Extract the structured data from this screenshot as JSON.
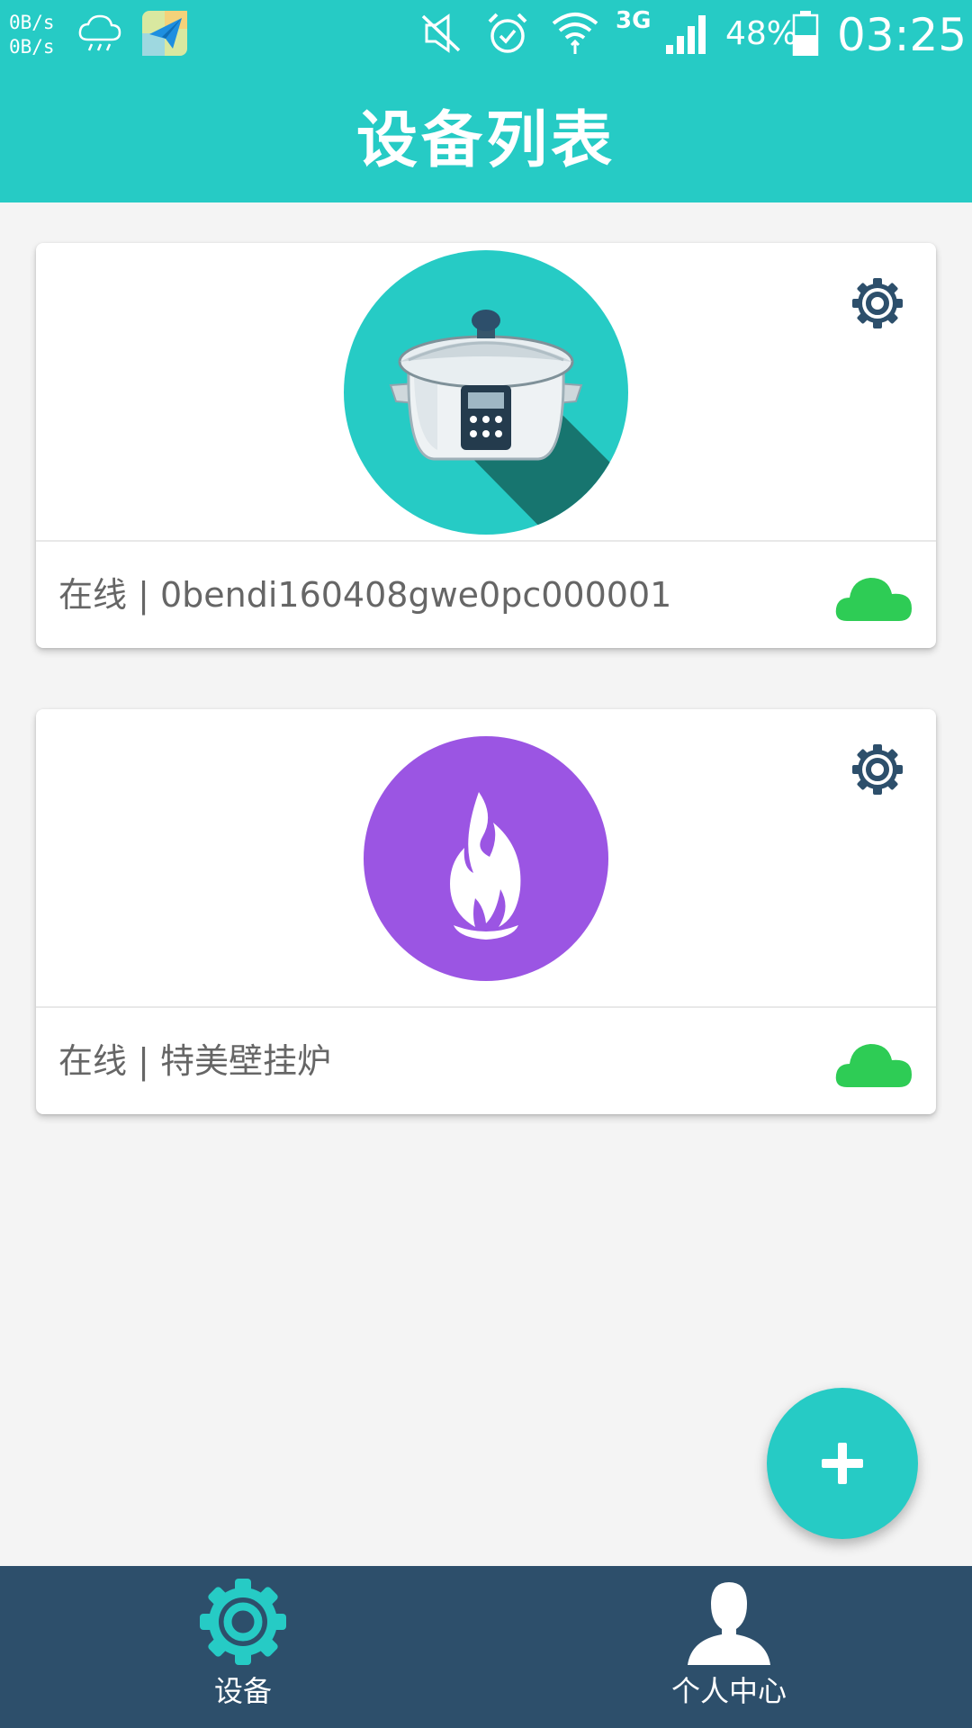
{
  "status_bar": {
    "net_up": "0B/s",
    "net_down": "0B/s",
    "network_type": "3G",
    "battery": "48%",
    "time": "03:25",
    "icons": [
      "rain-cloud-icon",
      "paper-plane-app-icon",
      "mute-icon",
      "alarm-icon",
      "wifi-icon",
      "signal-icon",
      "battery-icon"
    ]
  },
  "header": {
    "title": "设备列表"
  },
  "devices": [
    {
      "status_text": "在线 | 0bendi160408gwe0pc000001",
      "icon": "slow-cooker-icon",
      "avatar_color": "#26cbc5"
    },
    {
      "status_text": "在线 | 特美壁挂炉",
      "icon": "flame-icon",
      "avatar_color": "#9b55e3"
    }
  ],
  "fab": {
    "icon": "plus-icon"
  },
  "bottom_nav": {
    "items": [
      {
        "label": "设备",
        "icon": "gear-icon",
        "active": true
      },
      {
        "label": "个人中心",
        "icon": "person-icon",
        "active": false
      }
    ]
  },
  "colors": {
    "primary": "#26cbc5",
    "nav_background": "#2d4f6b",
    "online_cloud": "#2ecc55",
    "settings_icon": "#2d4f6b"
  }
}
